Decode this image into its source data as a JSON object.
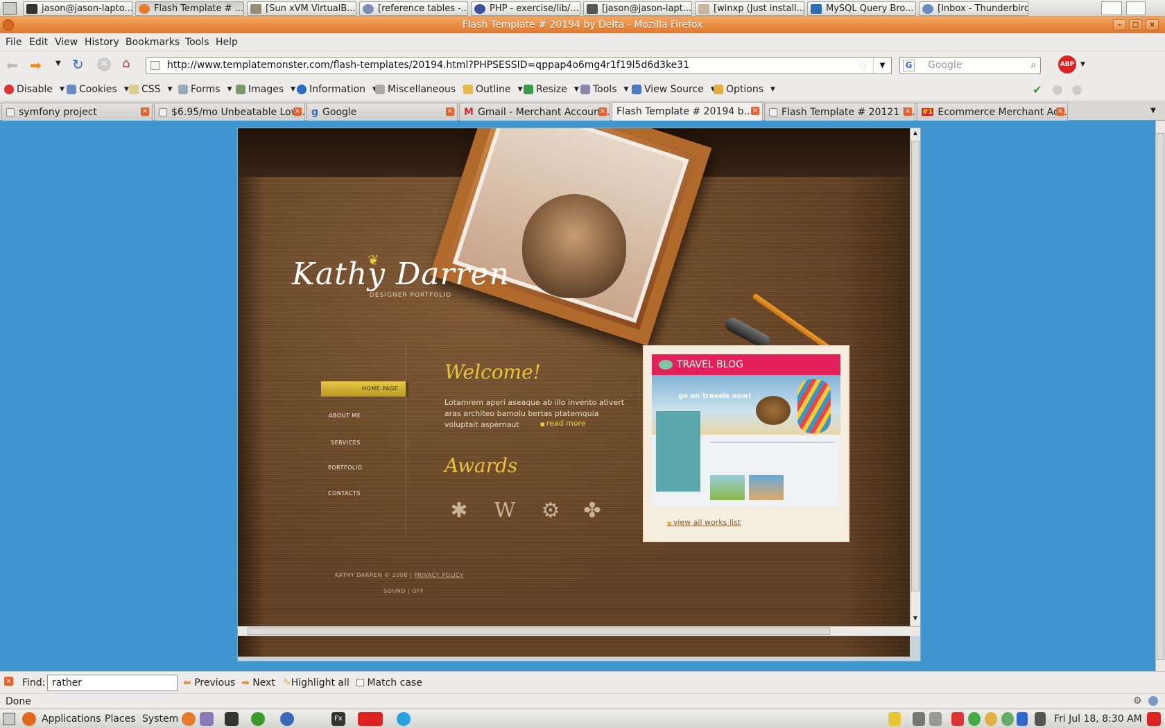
{
  "taskbar": {
    "tasks": [
      "jason@jason-lapto...",
      "Flash Template # ...",
      "[Sun xVM VirtualB...",
      "[reference tables -...",
      "PHP - exercise/lib/...",
      "[jason@jason-lapt...",
      "[winxp (Just install...",
      "MySQL Query Bro...",
      "[Inbox - Thunderbird]"
    ]
  },
  "window": {
    "title": "Flash Template # 20194 by Delta - Mozilla Firefox"
  },
  "menus": [
    "File",
    "Edit",
    "View",
    "History",
    "Bookmarks",
    "Tools",
    "Help"
  ],
  "nav": {
    "url": "http://www.templatemonster.com/flash-templates/20194.html?PHPSESSID=qppap4o6mg4r1f19l5d6d3ke31",
    "search_placeholder": "Google"
  },
  "devbar": [
    "Disable",
    "Cookies",
    "CSS",
    "Forms",
    "Images",
    "Information",
    "Miscellaneous",
    "Outline",
    "Resize",
    "Tools",
    "View Source",
    "Options"
  ],
  "tabs": [
    "symfony project",
    "$6.95/mo Unbeatable Low ...",
    "Google",
    "Gmail - Merchant Account ...",
    "Flash Template # 20194 b...",
    "Flash Template # 20121 b...",
    "Ecommerce Merchant Acc..."
  ],
  "site": {
    "logo": "Kathy Darren",
    "logo_sub": "DESIGNER PORTFOLIO",
    "nav": [
      "HOME PAGE",
      "ABOUT ME",
      "SERVICES",
      "PORTFOLIO",
      "CONTACTS"
    ],
    "welcome_title": "Welcome!",
    "welcome_text": "Lotamrem aperi aseaque ab illo invento ativert aras architeo bamolu bertas ptatemquia voluptait aspernaut",
    "read_more": "read more",
    "awards_title": "Awards",
    "preview_title": "TRAVEL BLOG",
    "preview_hero": "go on travels now!",
    "view_all": "view all works list",
    "footer_copy": "KATHY DARREN © 2008",
    "footer_policy": "PRIVACY POLICY",
    "sound": "SOUND",
    "sound_state": "OFF"
  },
  "find": {
    "label": "Find:",
    "value": "rather",
    "prev": "Previous",
    "next": "Next",
    "highlight": "Highlight all",
    "match_case": "Match case"
  },
  "status": {
    "text": "Done"
  },
  "panel": {
    "applications": "Applications",
    "places": "Places",
    "system": "System",
    "datetime": "Fri Jul 18,  8:30 AM"
  },
  "colors": {
    "accent": "#e0782c",
    "desktop": "#3f95cd",
    "site_gold": "#e6c53a"
  }
}
